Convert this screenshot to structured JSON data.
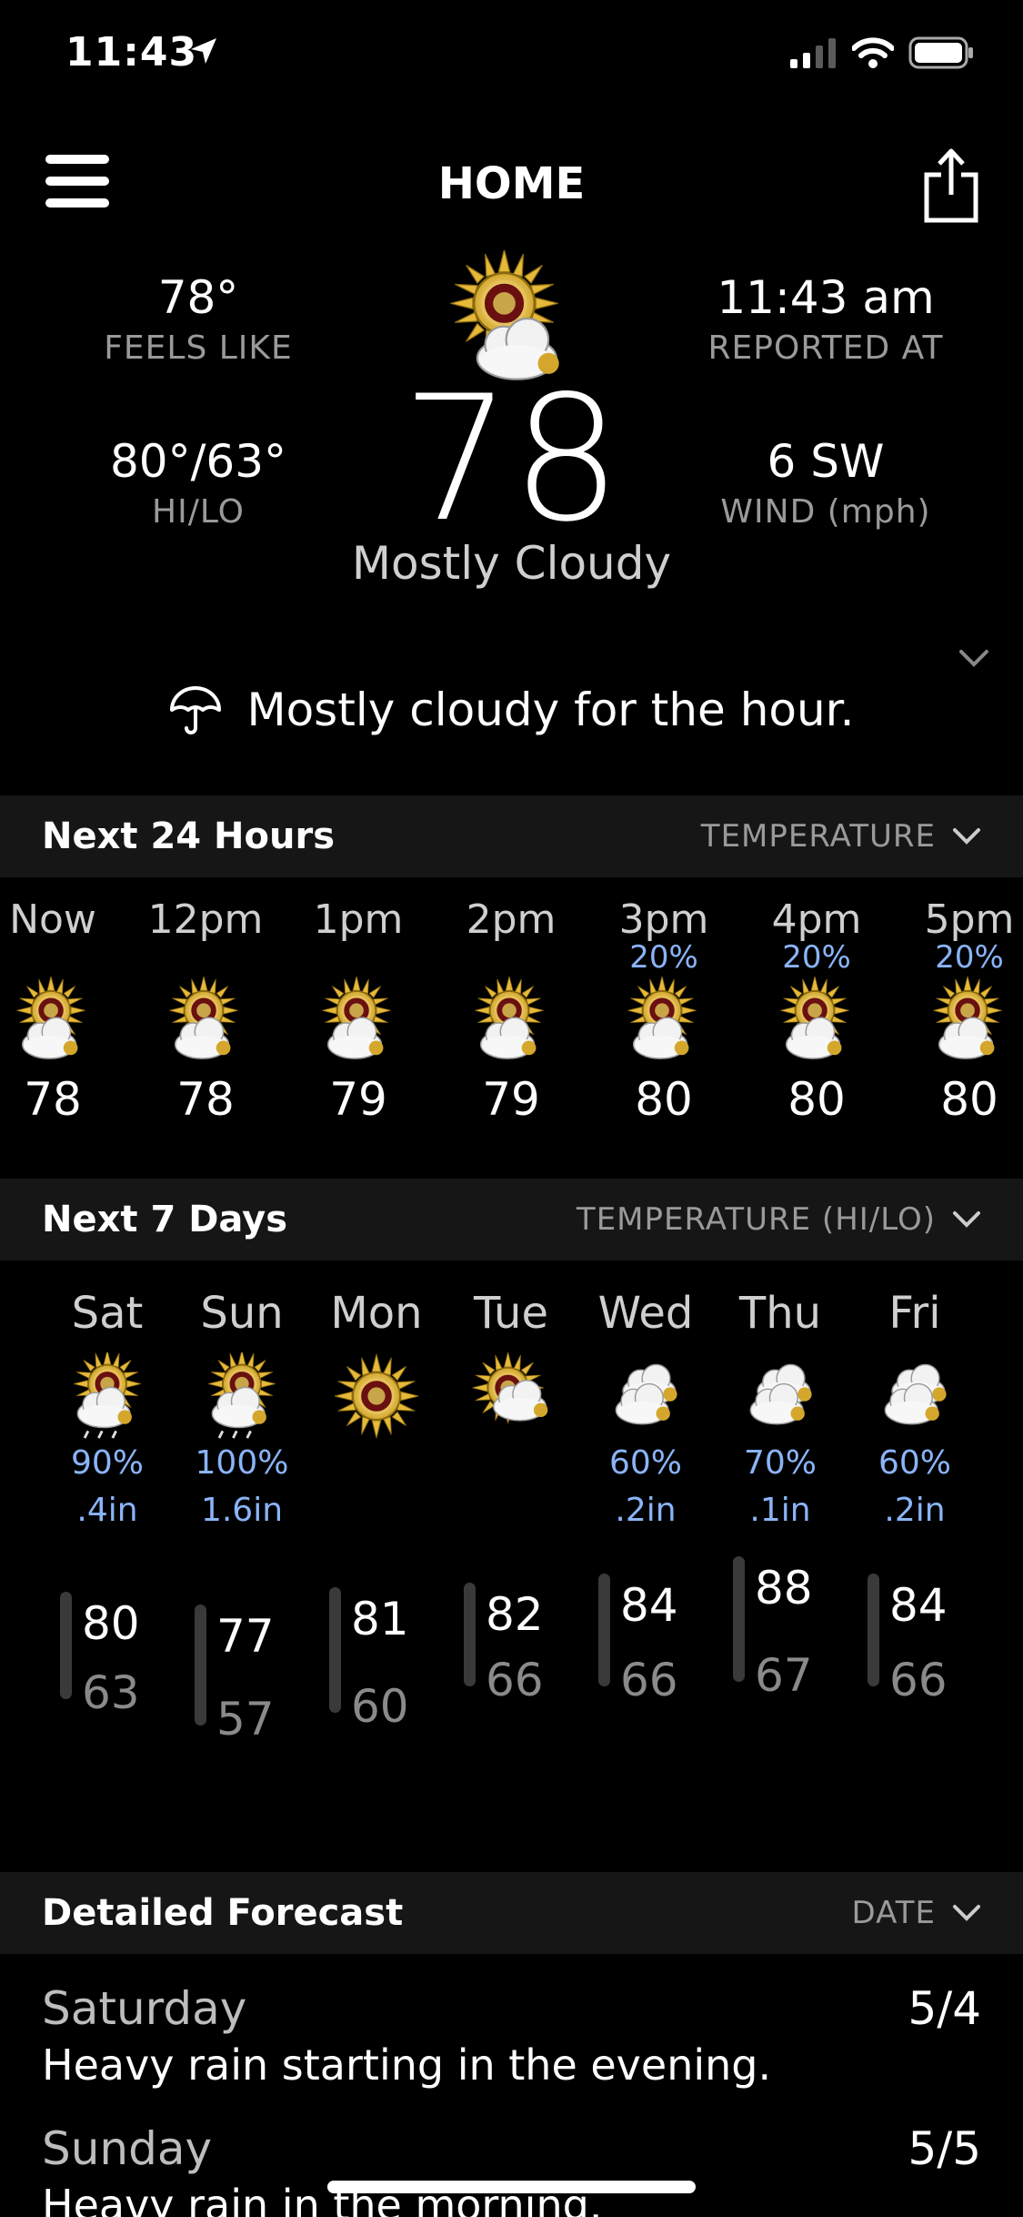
{
  "status_bar": {
    "time": "11:43"
  },
  "header": {
    "title": "HOME"
  },
  "current": {
    "feels_like": "78°",
    "feels_like_label": "FEELS LIKE",
    "reported_at": "11:43 am",
    "reported_at_label": "REPORTED AT",
    "hi_lo": "80°/63°",
    "hi_lo_label": "HI/LO",
    "wind": "6 SW",
    "wind_label": "WIND (mph)",
    "temp": "78",
    "condition": "Mostly Cloudy",
    "hour_summary": "Mostly cloudy for the hour."
  },
  "hourly_section": {
    "title": "Next 24 Hours",
    "sort": "TEMPERATURE",
    "hours": [
      {
        "label": "Now",
        "pop": "",
        "temp": "78"
      },
      {
        "label": "12pm",
        "pop": "",
        "temp": "78"
      },
      {
        "label": "1pm",
        "pop": "",
        "temp": "79"
      },
      {
        "label": "2pm",
        "pop": "",
        "temp": "79"
      },
      {
        "label": "3pm",
        "pop": "20%",
        "temp": "80"
      },
      {
        "label": "4pm",
        "pop": "20%",
        "temp": "80"
      },
      {
        "label": "5pm",
        "pop": "20%",
        "temp": "80"
      }
    ]
  },
  "daily_section": {
    "title": "Next 7 Days",
    "sort": "TEMPERATURE (HI/LO)",
    "days": [
      {
        "name": "Sat",
        "icon": "sun-cloud-rain-icon",
        "pop": "90%",
        "amount": ".4in",
        "hi": "80",
        "lo": "63"
      },
      {
        "name": "Sun",
        "icon": "sun-cloud-rain-icon",
        "pop": "100%",
        "amount": "1.6in",
        "hi": "77",
        "lo": "57"
      },
      {
        "name": "Mon",
        "icon": "sun-icon",
        "pop": "",
        "amount": "",
        "hi": "81",
        "lo": "60"
      },
      {
        "name": "Tue",
        "icon": "sun-cloud-icon",
        "pop": "",
        "amount": "",
        "hi": "82",
        "lo": "66"
      },
      {
        "name": "Wed",
        "icon": "cloud-icon",
        "pop": "60%",
        "amount": ".2in",
        "hi": "84",
        "lo": "66"
      },
      {
        "name": "Thu",
        "icon": "cloud-icon",
        "pop": "70%",
        "amount": ".1in",
        "hi": "88",
        "lo": "67"
      },
      {
        "name": "Fri",
        "icon": "cloud-icon",
        "pop": "60%",
        "amount": ".2in",
        "hi": "84",
        "lo": "66"
      }
    ]
  },
  "detail_section": {
    "title": "Detailed Forecast",
    "sort": "DATE",
    "items": [
      {
        "day": "Saturday",
        "date": "5/4",
        "text": "Heavy rain starting in the evening."
      },
      {
        "day": "Sunday",
        "date": "5/5",
        "text": "Heavy rain in the morning."
      }
    ]
  },
  "colors": {
    "background": "#000000",
    "section_bar": "#161616",
    "precip": "#8ab4f8",
    "muted": "#9a9a9a"
  }
}
